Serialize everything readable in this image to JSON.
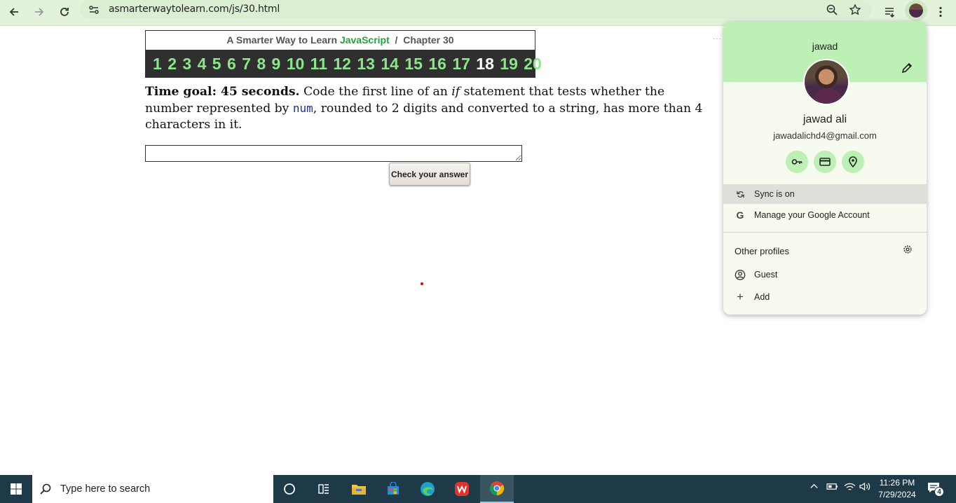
{
  "browser": {
    "url": "asmarterwaytolearn.com/js/30.html"
  },
  "chapter": {
    "title_prefix": "A Smarter Way to Learn ",
    "title_js": "JavaScript",
    "title_suffix": "  /  Chapter 30",
    "nav": [
      "1",
      "2",
      "3",
      "4",
      "5",
      "6",
      "7",
      "8",
      "9",
      "10",
      "11",
      "12",
      "13",
      "14",
      "15",
      "16",
      "17",
      "18",
      "19",
      "20"
    ],
    "current": "18"
  },
  "question": {
    "goal_label": "Time goal: 45 seconds.",
    "text_1": " Code the first line of an ",
    "italic_word": "if",
    "text_2": " statement that tests whether the number represented by ",
    "code_word": "num",
    "text_3": ", rounded to 2 digits and converted to a string, has more than 4 characters in it."
  },
  "answer": {
    "value": "",
    "check_label": "Check your answer"
  },
  "profile": {
    "display_name": "jawad",
    "full_name": "jawad ali",
    "email": "jawadalichd4@gmail.com",
    "sync_label": "Sync is on",
    "manage_label": "Manage your Google Account",
    "other_profiles_label": "Other profiles",
    "guest_label": "Guest",
    "add_label": "Add"
  },
  "taskbar": {
    "search_placeholder": "Type here to search",
    "time": "11:26 PM",
    "date": "7/29/2024",
    "notification_count": "4"
  },
  "colors": {
    "toolbar": "#e3f2db",
    "popup_header": "#bdf0b4",
    "chapter_link": "#8be68a",
    "taskbar": "#1e3947"
  }
}
